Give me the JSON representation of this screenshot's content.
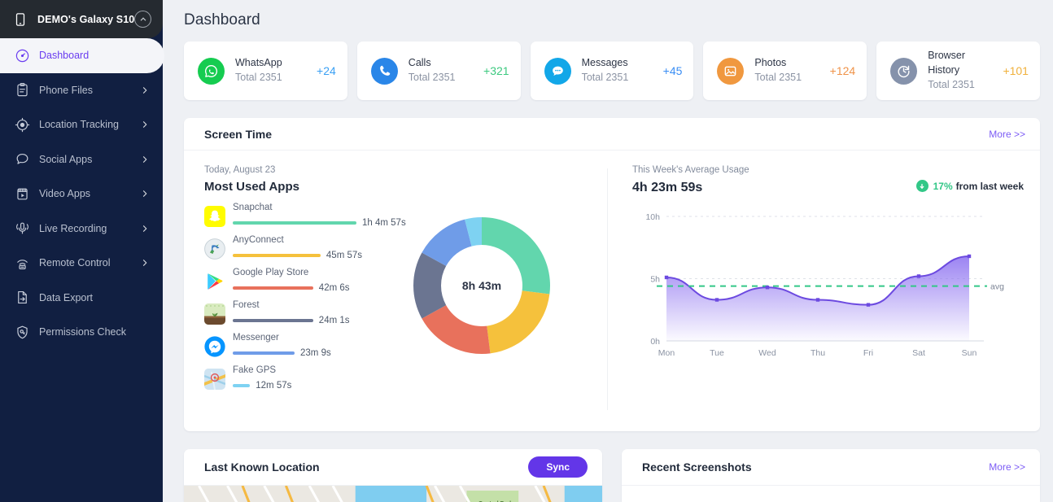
{
  "sidebar": {
    "device": {
      "name": "DEMO's Galaxy S10",
      "icon": "phone-icon",
      "collapse_icon": "chevron-up-icon"
    },
    "items": [
      {
        "label": "Dashboard",
        "icon": "speedometer-icon",
        "active": true,
        "expandable": false
      },
      {
        "label": "Phone Files",
        "icon": "clipboard-icon",
        "active": false,
        "expandable": true
      },
      {
        "label": "Location Tracking",
        "icon": "location-pin-icon",
        "active": false,
        "expandable": true
      },
      {
        "label": "Social Apps",
        "icon": "chat-bubble-icon",
        "active": false,
        "expandable": true
      },
      {
        "label": "Video Apps",
        "icon": "video-player-icon",
        "active": false,
        "expandable": true
      },
      {
        "label": "Live Recording",
        "icon": "microphone-icon",
        "active": false,
        "expandable": true
      },
      {
        "label": "Remote Control",
        "icon": "remote-wifi-icon",
        "active": false,
        "expandable": true
      },
      {
        "label": "Data Export",
        "icon": "export-file-icon",
        "active": false,
        "expandable": false
      },
      {
        "label": "Permissions Check",
        "icon": "shield-key-icon",
        "active": false,
        "expandable": false
      }
    ]
  },
  "page": {
    "title": "Dashboard"
  },
  "stats": [
    {
      "name": "WhatsApp",
      "total": "Total 2351",
      "delta": "+24",
      "delta_color": "#3aa0f4",
      "icon": "whatsapp-icon",
      "icon_bg": "#15cc50"
    },
    {
      "name": "Calls",
      "total": "Total 2351",
      "delta": "+321",
      "delta_color": "#3cc97f",
      "icon": "phone-call-icon",
      "icon_bg": "#2a86e8"
    },
    {
      "name": "Messages",
      "total": "Total 2351",
      "delta": "+45",
      "delta_color": "#3a8ef4",
      "icon": "message-icon",
      "icon_bg": "#12a7e8"
    },
    {
      "name": "Photos",
      "total": "Total 2351",
      "delta": "+124",
      "delta_color": "#ef9349",
      "icon": "photo-icon",
      "icon_bg": "#f0983f"
    },
    {
      "name": "Browser History",
      "total": "Total 2351",
      "delta": "+101",
      "delta_color": "#f0b13c",
      "icon": "browser-history-icon",
      "icon_bg": "#8592ab"
    }
  ],
  "screen_time": {
    "title": "Screen Time",
    "more_label": "More >>",
    "today_label": "Today, August 23",
    "most_used_title": "Most Used Apps",
    "donut_center": "8h 43m",
    "apps": [
      {
        "name": "Snapchat",
        "duration": "1h 4m 57s",
        "bar_pct": 100,
        "color": "#62d6ad",
        "icon": "snapchat-icon"
      },
      {
        "name": "AnyConnect",
        "duration": "45m 57s",
        "bar_pct": 71,
        "color": "#f5c13c",
        "icon": "anyconnect-icon"
      },
      {
        "name": "Google Play Store",
        "duration": "42m 6s",
        "bar_pct": 65,
        "color": "#e8715c",
        "icon": "google-play-icon"
      },
      {
        "name": "Forest",
        "duration": "24m 1s",
        "bar_pct": 65,
        "color": "#6b7591",
        "icon": "forest-icon"
      },
      {
        "name": "Messenger",
        "duration": "23m 9s",
        "bar_pct": 50,
        "color": "#6f9ce8",
        "icon": "messenger-icon"
      },
      {
        "name": "Fake GPS",
        "duration": "12m 57s",
        "bar_pct": 14,
        "color": "#7ed2f2",
        "icon": "fake-gps-icon"
      }
    ],
    "week": {
      "label": "This Week's Average Usage",
      "value": "4h 23m 59s",
      "trend_pct": "17%",
      "trend_text": "from last week",
      "trend_icon": "arrow-down-circle-icon"
    }
  },
  "chart_data": [
    {
      "type": "pie",
      "title": "Most Used Apps Distribution",
      "center_label": "8h 43m",
      "labels": [
        "Snapchat",
        "AnyConnect",
        "Google Play Store",
        "Forest",
        "Messenger",
        "Fake GPS"
      ],
      "values": [
        27,
        21,
        19,
        16,
        13,
        4
      ],
      "colors": [
        "#62d6ad",
        "#f5c13c",
        "#e8715c",
        "#6b7591",
        "#6f9ce8",
        "#7ed2f2"
      ],
      "legend": "none"
    },
    {
      "type": "area",
      "title": "This Week's Average Usage",
      "x": [
        "Mon",
        "Tue",
        "Wed",
        "Thu",
        "Fri",
        "Sat",
        "Sun"
      ],
      "values": [
        5.1,
        3.3,
        4.3,
        3.3,
        2.9,
        5.2,
        6.8
      ],
      "ylabel": "",
      "xlabel": "",
      "ylim": [
        0,
        10
      ],
      "ytick_labels": [
        "0h",
        "5h",
        "10h"
      ],
      "ytick_values": [
        0,
        5,
        10
      ],
      "grid": true,
      "line_color": "#6c4ae0",
      "fill_color": "#8a6ef0",
      "avg_line": {
        "value": 4.4,
        "label": "avg",
        "color": "#32c787",
        "style": "dashed"
      },
      "legend": "none"
    }
  ],
  "location_panel": {
    "title": "Last Known Location",
    "sync_label": "Sync",
    "map_label": "Central Park"
  },
  "screenshots_panel": {
    "title": "Recent Screenshots",
    "more_label": "More >>"
  },
  "colors": {
    "accent": "#6336e8",
    "sidebar_bg": "#111f41",
    "header_bg": "#252a30",
    "page_bg": "#eef0f4"
  }
}
